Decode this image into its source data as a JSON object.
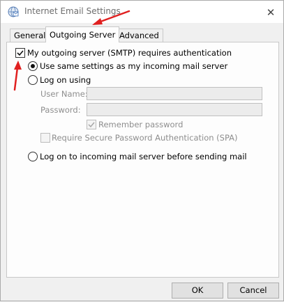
{
  "window": {
    "title": "Internet Email Settings",
    "close_glyph": "✕"
  },
  "tabs": [
    {
      "label": "General"
    },
    {
      "label": "Outgoing Server"
    },
    {
      "label": "Advanced"
    }
  ],
  "outgoing": {
    "requires_auth_label": "My outgoing server (SMTP) requires authentication",
    "requires_auth_checked": true,
    "same_settings_label": "Use same settings as my incoming mail server",
    "log_on_using_label": "Log on using",
    "user_name_label": "User Name:",
    "user_name_value": "",
    "password_label": "Password:",
    "password_value": "",
    "remember_password_label": "Remember password",
    "remember_password_checked": true,
    "spa_label": "Require Secure Password Authentication (SPA)",
    "spa_checked": false,
    "log_on_incoming_label": "Log on to incoming mail server before sending mail",
    "selected_option": "same_settings"
  },
  "buttons": {
    "ok_label": "OK",
    "cancel_label": "Cancel"
  },
  "colors": {
    "annotation_arrow": "#e02020"
  }
}
